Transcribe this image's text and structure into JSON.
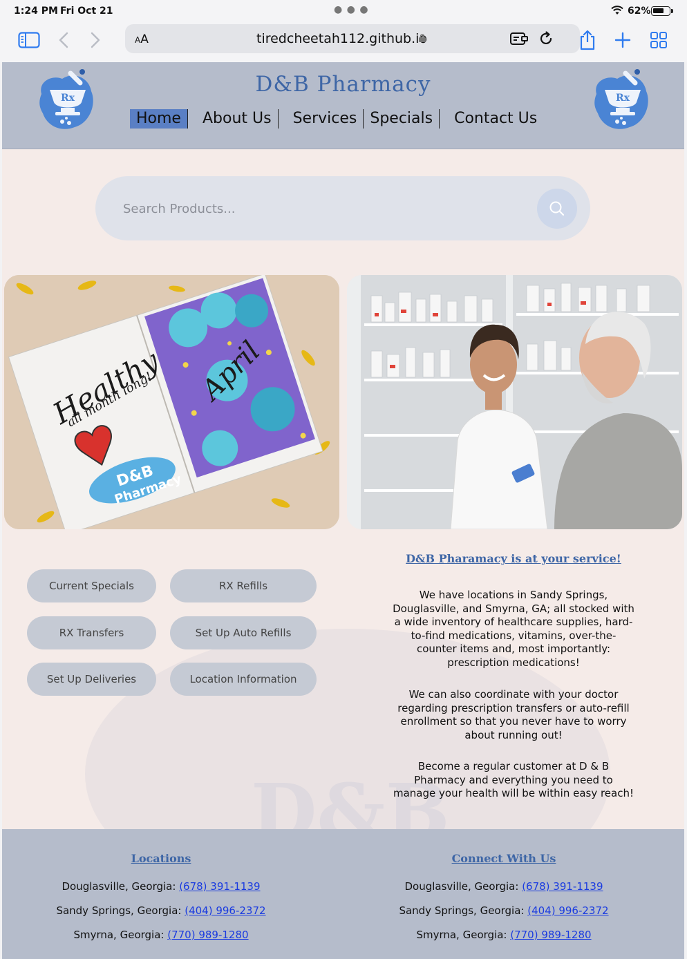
{
  "status": {
    "time": "1:24 PM",
    "date": "Fri Oct 21",
    "battery": "62%"
  },
  "browser": {
    "text_size_label": "AA",
    "url": "tiredcheetah112.github.io"
  },
  "site": {
    "title": "D&B Pharmacy",
    "nav": [
      "Home",
      "About Us",
      "Services",
      "Specials",
      "Contact Us"
    ]
  },
  "search": {
    "placeholder": "Search Products..."
  },
  "quick_links": [
    "Current Specials",
    "RX Refills",
    "RX Transfers",
    "Set Up Auto Refills",
    "Set Up Deliveries",
    "Location Information"
  ],
  "info": {
    "heading": "D&B Pharamacy is at your service!",
    "p1": "We have locations in Sandy Springs, Douglasville, and Smyrna, GA; all stocked with a wide inventory of healthcare supplies, hard-to-find medications, vitamins, over-the-counter items and, most importantly: prescription medications!",
    "p2": "We can also coordinate with your doctor regarding prescription transfers or auto-refill enrollment so that you never have to worry about running out!",
    "p3": "Become a regular customer at D & B Pharmacy and everything you need to manage your health will be within easy reach!"
  },
  "hero_images": {
    "left_text_1": "Healthy",
    "left_text_2": "all month long!",
    "left_text_3": "April",
    "left_badge_1": "D&B",
    "left_badge_2": "Pharmacy"
  },
  "footer": {
    "locations_heading": "Locations",
    "connect_heading": "Connect With Us",
    "locations": [
      {
        "label": "Douglasville, Georgia:",
        "phone": "(678) 391-1139"
      },
      {
        "label": "Sandy Springs, Georgia:",
        "phone": "(404) 996-2372"
      },
      {
        "label": "Smyrna, Georgia:",
        "phone": "(770) 989-1280"
      }
    ],
    "connect": [
      {
        "label": "Douglasville, Georgia:",
        "phone": "(678) 391-1139"
      },
      {
        "label": "Sandy Springs, Georgia:",
        "phone": "(404) 996-2372"
      },
      {
        "label": "Smyrna, Georgia:",
        "phone": "(770) 989-1280"
      }
    ]
  },
  "colors": {
    "header_bg": "#b5bccb",
    "page_bg": "#f5ebe8",
    "brand_blue": "#3e66a6",
    "nav_active": "#5a7fc4",
    "link": "#1a3be0",
    "ios_blue": "#2f7bef"
  }
}
